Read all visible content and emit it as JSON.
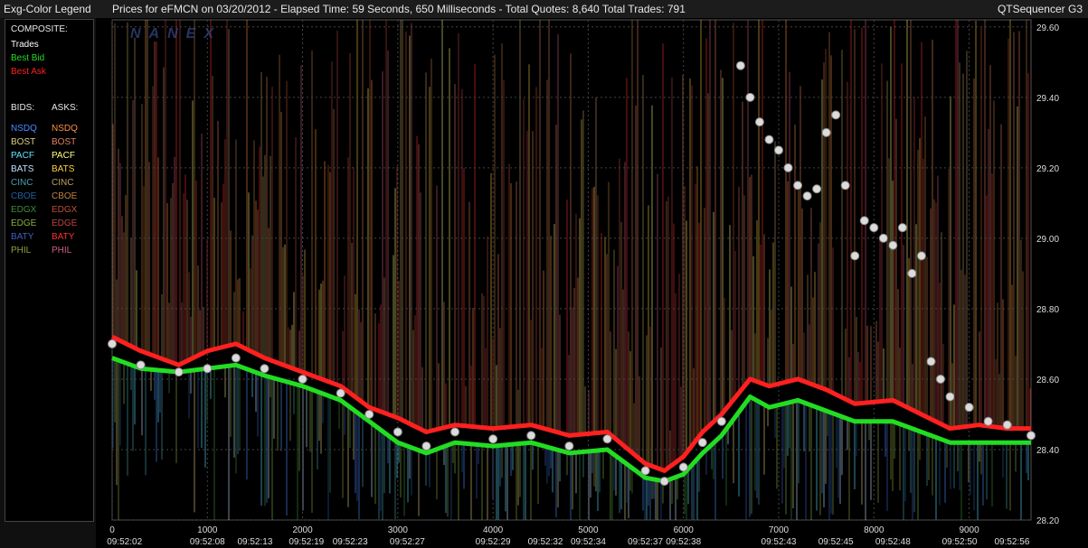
{
  "legend": {
    "header": "Exg-Color Legend",
    "composite_label": "COMPOSITE:",
    "composite_items": [
      {
        "label": "Trades",
        "color": "#ffffff"
      },
      {
        "label": "Best Bid",
        "color": "#22dd22"
      },
      {
        "label": "Best Ask",
        "color": "#ff2020"
      }
    ],
    "bids_label": "BIDS:",
    "asks_label": "ASKS:",
    "bids": [
      {
        "label": "NSDQ",
        "color": "#4a8cff"
      },
      {
        "label": "BOST",
        "color": "#e0d080"
      },
      {
        "label": "PACF",
        "color": "#60e0ff"
      },
      {
        "label": "BATS",
        "color": "#c0e0ff"
      },
      {
        "label": "CINC",
        "color": "#4aa0b0"
      },
      {
        "label": "CBOE",
        "color": "#2060a0"
      },
      {
        "label": "EDGX",
        "color": "#3c8c3c"
      },
      {
        "label": "EDGE",
        "color": "#88b040"
      },
      {
        "label": "BATY",
        "color": "#4060c0"
      },
      {
        "label": "PHIL",
        "color": "#90a040"
      }
    ],
    "asks": [
      {
        "label": "NSDQ",
        "color": "#ff9040"
      },
      {
        "label": "BOST",
        "color": "#e08060"
      },
      {
        "label": "PACF",
        "color": "#ffff80"
      },
      {
        "label": "BATS",
        "color": "#ffd040"
      },
      {
        "label": "CINC",
        "color": "#c0a060"
      },
      {
        "label": "CBOE",
        "color": "#c08040"
      },
      {
        "label": "EDGX",
        "color": "#c05030"
      },
      {
        "label": "EDGE",
        "color": "#c04040"
      },
      {
        "label": "BATY",
        "color": "#ff3030"
      },
      {
        "label": "PHIL",
        "color": "#d06080"
      }
    ]
  },
  "header": {
    "title": "Prices for  eFMCN  on  03/20/2012  -  Elapsed Time: 59 Seconds, 650 Milliseconds  -  Total Quotes: 8,640  Total Trades: 791",
    "app_name": "QTSequencer G3"
  },
  "watermark": "NANEX",
  "chart_data": {
    "type": "line",
    "title": "",
    "xlim": [
      0,
      9650
    ],
    "ylim": [
      28.2,
      29.62
    ],
    "y_ticks": [
      "29.60",
      "29.40",
      "29.20",
      "29.00",
      "28.80",
      "28.60",
      "28.40",
      "28.20"
    ],
    "y_tick_values": [
      29.6,
      29.4,
      29.2,
      29.0,
      28.8,
      28.6,
      28.4,
      28.2
    ],
    "x_ticks": [
      "0",
      "1000",
      "2000",
      "3000",
      "4000",
      "5000",
      "6000",
      "7000",
      "8000",
      "9000"
    ],
    "x_tick_values": [
      0,
      1000,
      2000,
      3000,
      4000,
      5000,
      6000,
      7000,
      8000,
      9000
    ],
    "time_labels": [
      "09:52:02",
      "09:52:08",
      "09:52:13",
      "09:52:19",
      "09:52:23",
      "09:52:27",
      "09:52:29",
      "09:52:32",
      "09:52:34",
      "09:52:37",
      "09:52:38",
      "09:52:43",
      "09:52:45",
      "09:52:48",
      "09:52:50",
      "09:52:56"
    ],
    "time_label_x": [
      130,
      1000,
      1500,
      2040,
      2500,
      3100,
      4000,
      4550,
      5000,
      5600,
      6000,
      7000,
      7600,
      8200,
      8900,
      9450
    ],
    "series": [
      {
        "name": "Best Ask",
        "color": "#ff2020",
        "x": [
          0,
          300,
          700,
          1000,
          1300,
          1600,
          2000,
          2400,
          2700,
          3000,
          3300,
          3600,
          4000,
          4400,
          4800,
          5200,
          5600,
          5800,
          6000,
          6200,
          6400,
          6700,
          6900,
          7200,
          7500,
          7800,
          8200,
          8500,
          8800,
          9100,
          9400,
          9650
        ],
        "values": [
          28.72,
          28.68,
          28.64,
          28.68,
          28.7,
          28.66,
          28.62,
          28.58,
          28.52,
          28.49,
          28.45,
          28.47,
          28.46,
          28.47,
          28.44,
          28.45,
          28.36,
          28.34,
          28.38,
          28.45,
          28.5,
          28.6,
          28.58,
          28.6,
          28.57,
          28.53,
          28.54,
          28.5,
          28.46,
          28.47,
          28.46,
          28.46
        ]
      },
      {
        "name": "Best Bid",
        "color": "#22dd22",
        "x": [
          0,
          300,
          700,
          1000,
          1300,
          1600,
          2000,
          2400,
          2700,
          3000,
          3300,
          3600,
          4000,
          4400,
          4800,
          5200,
          5600,
          5800,
          6000,
          6200,
          6400,
          6700,
          6900,
          7200,
          7500,
          7800,
          8200,
          8500,
          8800,
          9100,
          9400,
          9650
        ],
        "values": [
          28.66,
          28.63,
          28.62,
          28.63,
          28.64,
          28.61,
          28.58,
          28.54,
          28.48,
          28.42,
          28.39,
          28.42,
          28.41,
          28.42,
          28.39,
          28.4,
          28.32,
          28.31,
          28.33,
          28.39,
          28.44,
          28.55,
          28.52,
          28.54,
          28.51,
          28.48,
          28.48,
          28.45,
          28.42,
          28.42,
          28.42,
          28.42
        ]
      },
      {
        "name": "Trades",
        "color": "#dcdcdc",
        "x": [
          0,
          300,
          700,
          1000,
          1300,
          1600,
          2000,
          2400,
          2700,
          3000,
          3300,
          3600,
          4000,
          4400,
          4800,
          5200,
          5600,
          5800,
          6000,
          6200,
          6400,
          6600,
          6700,
          6800,
          6900,
          7000,
          7100,
          7200,
          7300,
          7400,
          7500,
          7600,
          7700,
          7800,
          7900,
          8000,
          8100,
          8200,
          8300,
          8400,
          8500,
          8600,
          8700,
          8800,
          9000,
          9200,
          9400,
          9650
        ],
        "values": [
          28.7,
          28.64,
          28.62,
          28.63,
          28.66,
          28.63,
          28.6,
          28.56,
          28.5,
          28.45,
          28.41,
          28.45,
          28.43,
          28.44,
          28.41,
          28.43,
          28.34,
          28.31,
          28.35,
          28.42,
          28.48,
          29.49,
          29.4,
          29.33,
          29.28,
          29.25,
          29.2,
          29.15,
          29.12,
          29.14,
          29.3,
          29.35,
          29.15,
          28.95,
          29.05,
          29.03,
          29.0,
          28.98,
          29.03,
          28.9,
          28.95,
          28.65,
          28.6,
          28.55,
          28.52,
          28.48,
          28.47,
          28.44
        ]
      }
    ],
    "annotations": [
      "NANEX"
    ]
  }
}
